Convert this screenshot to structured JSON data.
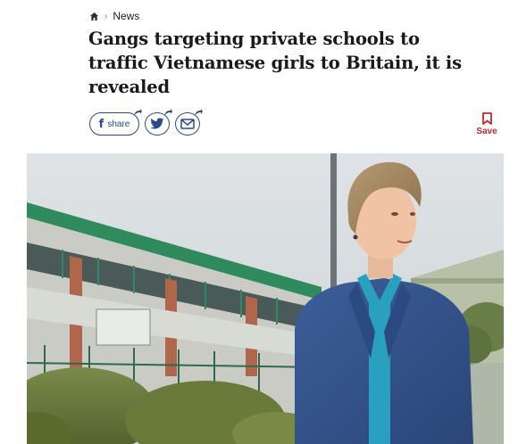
{
  "breadcrumb": {
    "home_icon": "home-icon",
    "separator": "›",
    "section": "News"
  },
  "article": {
    "headline": "Gangs targeting private schools to traffic Vietnamese girls to Britain, it is revealed"
  },
  "share": {
    "facebook_letter": "f",
    "facebook_label": "share",
    "twitter_icon": "twitter-icon",
    "email_icon": "email-icon"
  },
  "save": {
    "label": "Save",
    "icon": "bookmark-icon",
    "color": "#c0292a"
  },
  "hero_image": {
    "alt_description_shown": false
  },
  "colors": {
    "brand_blue": "#2a4a8a",
    "accent_red": "#c0292a",
    "text": "#1a1a1a"
  }
}
